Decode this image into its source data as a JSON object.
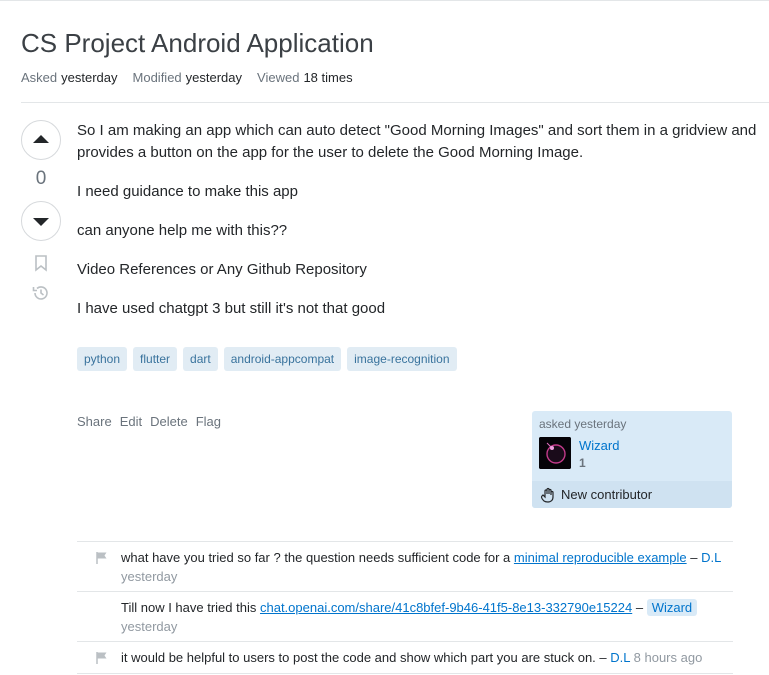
{
  "question": {
    "title": "CS Project Android Application",
    "meta": {
      "asked_label": "Asked",
      "asked_value": "yesterday",
      "modified_label": "Modified",
      "modified_value": "yesterday",
      "viewed_label": "Viewed",
      "viewed_value": "18 times"
    },
    "vote_count": "0",
    "body": [
      "So I am making an app which can auto detect \"Good Morning Images\" and sort them in a gridview and provides a button on the app for the user to delete the Good Morning Image.",
      "I need guidance to make this app",
      "can anyone help me with this??",
      "Video References or Any Github Repository",
      "I have used chatgpt 3 but still it's not that good"
    ],
    "tags": [
      "python",
      "flutter",
      "dart",
      "android-appcompat",
      "image-recognition"
    ],
    "menu": {
      "share": "Share",
      "edit": "Edit",
      "delete": "Delete",
      "flag": "Flag"
    },
    "user_card": {
      "action_time": "asked yesterday",
      "name": "Wizard",
      "reputation": "1",
      "new_contributor": "New contributor"
    }
  },
  "comments": [
    {
      "text": "what have you tried so far ? the question needs sufficient code for a",
      "link": "minimal reproducible example",
      "sep": "–",
      "user": "D.L",
      "date": "yesterday"
    },
    {
      "text": "Till now I have tried this",
      "link": "chat.openai.com/share/41c8bfef-9b46-41f5-8e13-332790e15224",
      "sep": "–",
      "user": "Wizard",
      "date": "yesterday"
    },
    {
      "text": "it would be helpful to users to post the code and show which part you are stuck on.",
      "sep": "–",
      "user": "D.L",
      "date": "8 hours ago"
    }
  ],
  "colors": {
    "link": "#0074cc",
    "tag_bg": "#e1ecf4",
    "tag_text": "#39739d",
    "user_card_bg": "#d9eaf7"
  },
  "icons": {
    "vote_up": "triangle-up-icon",
    "vote_down": "triangle-down-icon",
    "bookmark": "bookmark-icon",
    "history": "history-icon",
    "flag": "flag-icon",
    "new_contributor": "waving-hand-icon"
  }
}
